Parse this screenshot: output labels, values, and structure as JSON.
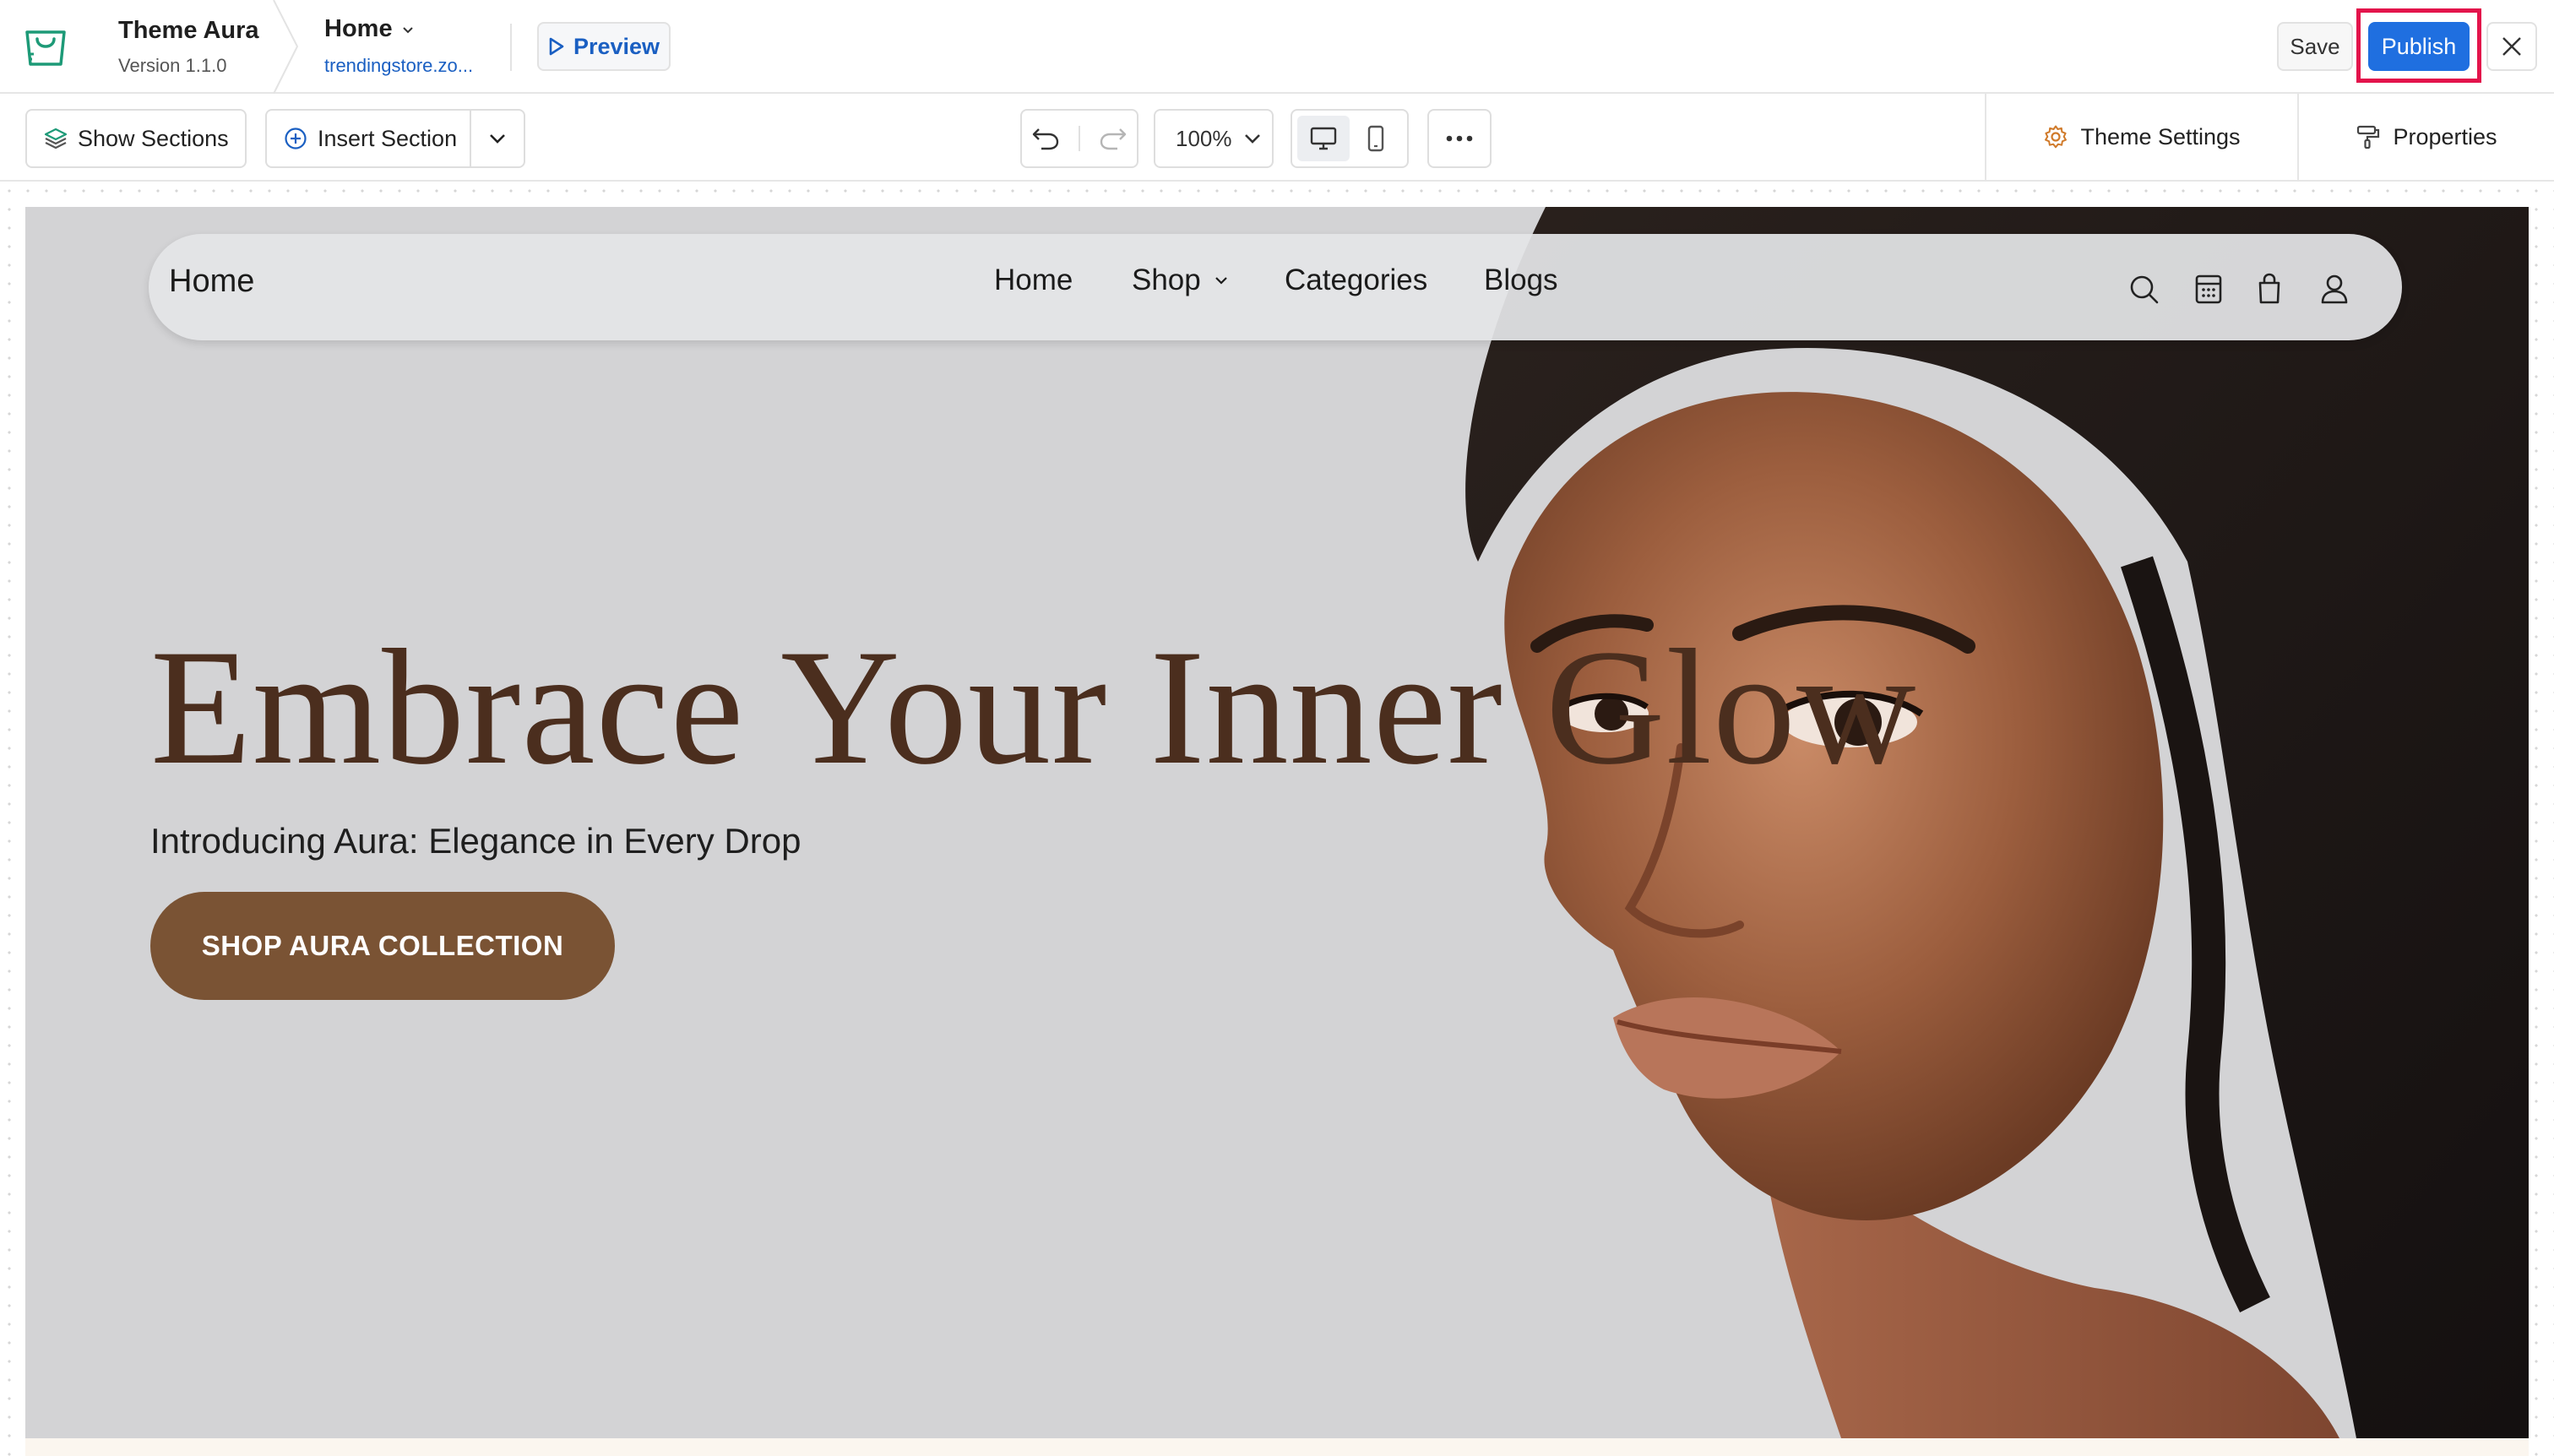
{
  "app": {
    "theme_name": "Theme Aura",
    "theme_version": "Version 1.1.0",
    "page_name": "Home",
    "page_url": "trendingstore.zo...",
    "preview_label": "Preview",
    "save_label": "Save",
    "publish_label": "Publish"
  },
  "toolbar": {
    "show_sections_label": "Show Sections",
    "insert_section_label": "Insert Section",
    "zoom_value": "100%",
    "theme_settings_label": "Theme Settings",
    "properties_label": "Properties"
  },
  "site": {
    "brand": "Home",
    "nav": [
      {
        "label": "Home"
      },
      {
        "label": "Shop"
      },
      {
        "label": "Categories"
      },
      {
        "label": "Blogs"
      }
    ],
    "hero": {
      "title": "Embrace Your Inner Glow",
      "subtitle": "Introducing Aura: Elegance in Every Drop",
      "cta_label": "SHOP AURA COLLECTION"
    }
  },
  "colors": {
    "accent_blue": "#1f6fe0",
    "publish_highlight": "#e3134b",
    "hero_background": "#d3d3d5",
    "hero_title": "#4b2e1e",
    "cta_background": "#7a5334"
  },
  "icons": [
    "store-bag-icon",
    "chevron-down-icon",
    "play-icon",
    "close-icon",
    "layers-icon",
    "plus-circle-icon",
    "undo-icon",
    "redo-icon",
    "desktop-icon",
    "mobile-icon",
    "more-icon",
    "gear-icon",
    "paint-roller-icon",
    "search-icon",
    "calendar-icon",
    "bag-icon",
    "user-icon"
  ]
}
